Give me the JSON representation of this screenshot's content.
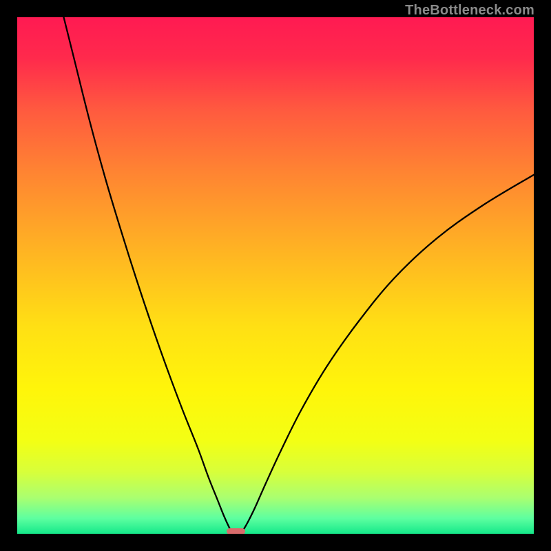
{
  "watermark": "TheBottleneck.com",
  "chart_data": {
    "type": "line",
    "title": "",
    "xlabel": "",
    "ylabel": "",
    "xlim": [
      0,
      100
    ],
    "ylim": [
      0,
      100
    ],
    "grid": false,
    "series": [
      {
        "name": "left-curve",
        "x": [
          9,
          11,
          14,
          17,
          20,
          23,
          26,
          29,
          32,
          35,
          37,
          38.8,
          40,
          41,
          41.7
        ],
        "y": [
          100,
          92,
          80,
          69,
          59,
          49.5,
          40.5,
          32,
          24,
          16.5,
          11,
          6.5,
          3.5,
          1.3,
          0
        ]
      },
      {
        "name": "right-curve",
        "x": [
          43.3,
          44.5,
          46,
          48,
          51,
          55,
          60,
          66,
          73,
          81,
          90,
          100
        ],
        "y": [
          0,
          2,
          5,
          9.5,
          16,
          24,
          32.5,
          41,
          49.5,
          57,
          63.5,
          69.5
        ]
      }
    ],
    "gradient_stops": [
      {
        "offset": 0.0,
        "color": "#ff1a52"
      },
      {
        "offset": 0.08,
        "color": "#ff2a4c"
      },
      {
        "offset": 0.18,
        "color": "#ff5a3f"
      },
      {
        "offset": 0.3,
        "color": "#ff8432"
      },
      {
        "offset": 0.45,
        "color": "#ffb323"
      },
      {
        "offset": 0.6,
        "color": "#ffe014"
      },
      {
        "offset": 0.72,
        "color": "#fff50a"
      },
      {
        "offset": 0.82,
        "color": "#f3ff14"
      },
      {
        "offset": 0.88,
        "color": "#d8ff3a"
      },
      {
        "offset": 0.93,
        "color": "#aaff70"
      },
      {
        "offset": 0.97,
        "color": "#5effa0"
      },
      {
        "offset": 1.0,
        "color": "#14e88a"
      }
    ],
    "curve_color": "#000000",
    "curve_width": 2.3,
    "marker": {
      "x": 42.3,
      "y": 0.5,
      "w": 3.6,
      "h": 1.2,
      "color": "#d86b6b"
    }
  }
}
